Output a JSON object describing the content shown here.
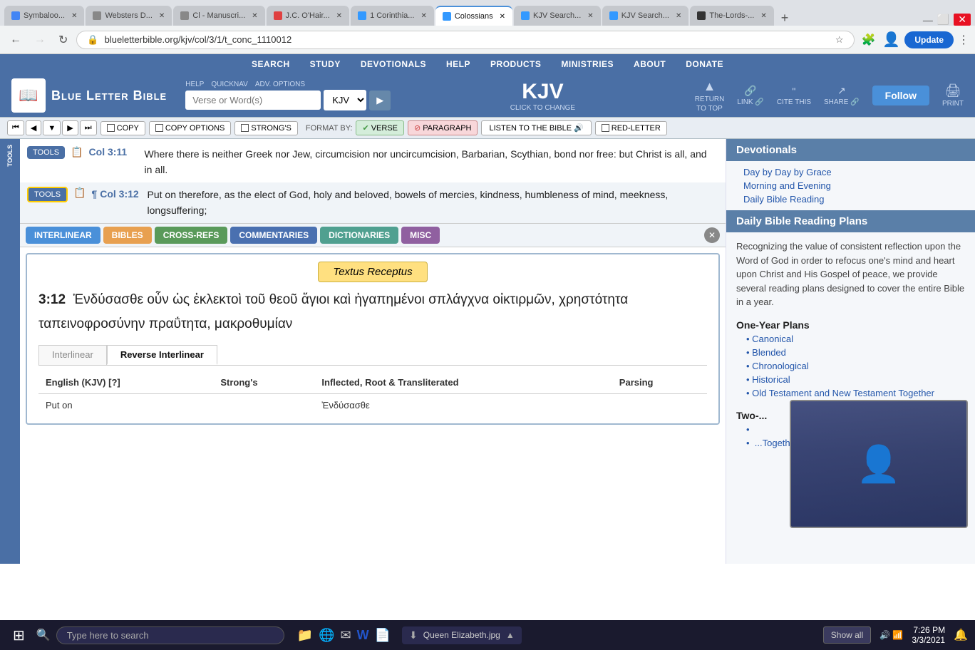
{
  "browser": {
    "tabs": [
      {
        "id": "symbaloo",
        "label": "Symbaloo...",
        "active": false,
        "color": "#e8f0fe"
      },
      {
        "id": "websters",
        "label": "Websters D...",
        "active": false,
        "color": "#e8f0fe"
      },
      {
        "id": "manuscript",
        "label": "Cl - Manuscri...",
        "active": false,
        "color": "#e8f0fe"
      },
      {
        "id": "jcohair",
        "label": "J.C. O'Hair...",
        "active": false,
        "color": "#e8f0fe"
      },
      {
        "id": "1corinthians",
        "label": "1 Corinthia...",
        "active": false,
        "color": "#e8f0fe"
      },
      {
        "id": "colossians",
        "label": "Colossians",
        "active": true,
        "color": "#fff"
      },
      {
        "id": "kjvsearch1",
        "label": "KJV Search...",
        "active": false,
        "color": "#e8f0fe"
      },
      {
        "id": "kjvsearch2",
        "label": "KJV Search...",
        "active": false,
        "color": "#e8f0fe"
      },
      {
        "id": "thelords",
        "label": "The-Lords-...",
        "active": false,
        "color": "#e8f0fe"
      }
    ],
    "url": "blueletterbible.org/kjv/col/3/1/t_conc_1110012",
    "update_label": "Update"
  },
  "nav": {
    "items": [
      "SEARCH",
      "STUDY",
      "DEVOTIONALS",
      "HELP",
      "PRODUCTS",
      "MINISTRIES",
      "ABOUT",
      "DONATE"
    ]
  },
  "logo": {
    "text": "Blue Letter Bible"
  },
  "search": {
    "placeholder": "Verse or Word(s)",
    "version": "KJV",
    "help_label": "HELP",
    "quicknav_label": "QUICKNAV",
    "adv_options_label": "ADV. OPTIONS"
  },
  "kjv": {
    "title": "KJV",
    "subtitle": "CLICK TO CHANGE"
  },
  "top_actions": {
    "link": "LINK 🔗",
    "cite_this": "CITE THIS",
    "return_to_top": "RETURN TO TOP",
    "share": "SHARE 🔗",
    "follow": "FOLLOW ▼",
    "print": "PRINT"
  },
  "toolbar": {
    "copy": "COPY",
    "copy_options": "COPY OPTIONS",
    "strongs": "STRONG'S",
    "format_by": "FORMAT BY:",
    "verse": "VERSE",
    "paragraph": "PARAGRAPH",
    "listen": "LISTEN TO THE BIBLE 🔊",
    "red_letter": "RED-LETTER"
  },
  "verses": [
    {
      "ref": "Col 3:11",
      "text": "Where there is neither Greek nor Jew, circumcision nor uncircumcision, Barbarian, Scythian, bond nor free: but Christ is all, and in all."
    },
    {
      "ref": "Col 3:12",
      "text": "Put on therefore, as the elect of God, holy and beloved, bowels of mercies, kindness, humbleness of mind, meekness, longsuffering;"
    }
  ],
  "tabs": {
    "items": [
      "INTERLINEAR",
      "BIBLES",
      "CROSS-REFS",
      "COMMENTARIES",
      "DICTIONARIES",
      "MISC"
    ]
  },
  "textus": {
    "label": "Textus Receptus",
    "verse_ref": "3:12",
    "greek_text": "Ἐνδύσασθε οὖν ὡς ἐκλεκτοὶ τοῦ θεοῦ ἅγιοι καὶ ἠγαπημένοι σπλάγχνα οἰκτιρμῶν, χρηστότητα ταπεινοφροσύνην πραΰτητα, μακροθυμίαν"
  },
  "interlinear": {
    "tabs": [
      "Interlinear",
      "Reverse Interlinear"
    ],
    "active_tab": "Reverse Interlinear",
    "columns": [
      "English (KJV) [?]",
      "Strong's",
      "Inflected, Root & Transliterated",
      "Parsing"
    ],
    "rows": [
      {
        "english": "Put on",
        "strongs": "",
        "transliterated": "Ἐνδύσασθε",
        "parsing": ""
      }
    ]
  },
  "right_sidebar": {
    "devotionals_title": "Devotionals",
    "devotionals_items": [
      "Day by Day by Grace",
      "Morning and Evening",
      "Daily Bible Reading"
    ],
    "daily_plans_title": "Daily Bible Reading Plans",
    "daily_plans_desc": "Recognizing the value of consistent reflection upon the Word of God in order to refocus one's mind and heart upon Christ and His Gospel of peace, we provide several reading plans designed to cover the entire Bible in a year.",
    "one_year_title": "One-Year Plans",
    "one_year_items": [
      "Canonical",
      "Blended",
      "Chronological",
      "Historical",
      "Old Testament and New Testament Together"
    ],
    "two_year_title": "Two-...",
    "follow_label": "Follow",
    "show_all": "Show all"
  },
  "taskbar": {
    "search_placeholder": "Type here to search",
    "time": "7:26 PM",
    "date": "3/3/2021",
    "download": "Queen Elizabeth.jpg",
    "show_all": "Show all"
  }
}
